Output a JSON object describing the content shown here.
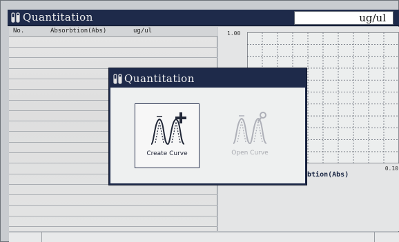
{
  "window": {
    "title": "Quantitation",
    "unit_display": "ug/ul"
  },
  "table": {
    "columns": [
      "No.",
      "Absorbtion(Abs)",
      "ug/ul"
    ],
    "rows": []
  },
  "graph": {
    "y_top_tick": "1.00",
    "x_right_tick": "0.10",
    "x_axis_label": "rbtion(Abs)"
  },
  "dialog": {
    "title": "Quantitation",
    "options": [
      {
        "label": "Create Curve",
        "icon": "create-curve-icon",
        "enabled": true
      },
      {
        "label": "Open Curve",
        "icon": "open-curve-icon",
        "enabled": false
      }
    ]
  },
  "colors": {
    "titlebar": "#1e2a4a",
    "accent_text": "#1a2744"
  }
}
